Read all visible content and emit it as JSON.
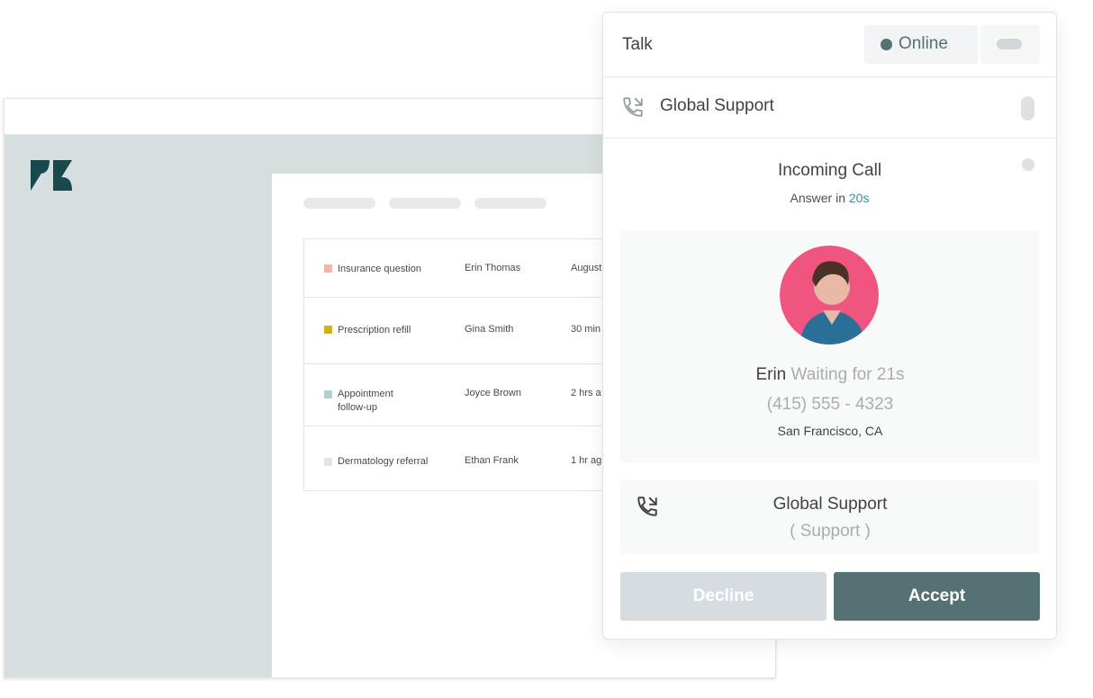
{
  "app": {
    "tickets": [
      {
        "subject": "Insurance question",
        "requester": "Erin Thomas",
        "time": "August",
        "tag_color": "#f0b4a8"
      },
      {
        "subject": "Prescription refill",
        "requester": "Gina Smith",
        "time": "30 min",
        "tag_color": "#d4ad28"
      },
      {
        "subject_line1": "Appointment",
        "subject_line2": "follow-up",
        "requester": "Joyce Brown",
        "time": "2 hrs a",
        "tag_color": "#b2d1cd"
      },
      {
        "subject": "Dermatology referral",
        "requester": "Ethan Frank",
        "time": "1 hr ag",
        "tag_color": "#dbe8f3"
      }
    ]
  },
  "talk": {
    "title": "Talk",
    "status": "Online",
    "group": "Global Support",
    "incoming": {
      "title": "Incoming Call",
      "answer_prefix": "Answer in ",
      "answer_seconds": "20s"
    },
    "caller": {
      "name": "Erin",
      "waiting": "Waiting for 21s",
      "phone": "(415) 555 - 4323",
      "location": "San Francisco, CA"
    },
    "queue": {
      "name": "Global Support",
      "sub": "( Support )"
    },
    "actions": {
      "decline": "Decline",
      "accept": "Accept"
    }
  },
  "colors": {
    "accent": "#567173",
    "online": "#577073",
    "countdown": "#3a8f9d",
    "avatar_bg": "#f0557f"
  }
}
